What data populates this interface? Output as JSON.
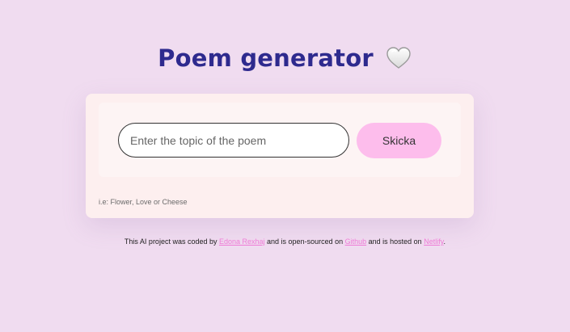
{
  "header": {
    "title": "Poem generator",
    "icon": "white-heart-icon"
  },
  "form": {
    "input_placeholder": "Enter the topic of the poem",
    "input_value": "",
    "submit_label": "Skicka",
    "hint": "i.e: Flower, Love or Cheese"
  },
  "footer": {
    "text_1": "This AI project was coded by ",
    "author_link": "Edona Rexhaj",
    "text_2": " and is open-sourced on ",
    "github_link": "Github",
    "text_3": " and is hosted on ",
    "netlify_link": "Netlify",
    "text_4": "."
  },
  "colors": {
    "background": "#f0dcf0",
    "title": "#2e2a8e",
    "button": "#fdbdec",
    "link": "#ee7bd6",
    "card": "#fdefef"
  }
}
